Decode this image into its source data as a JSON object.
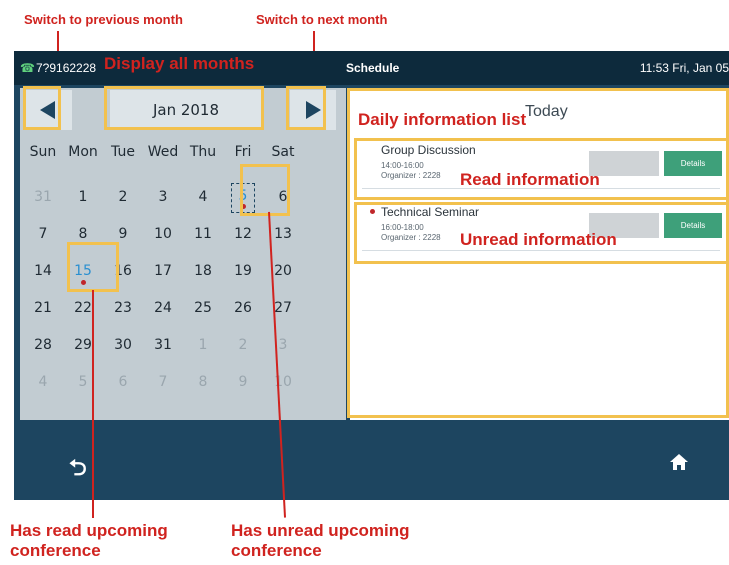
{
  "annotations": {
    "prev_month": "Switch to previous month",
    "next_month": "Switch to next month",
    "display_all": "Display all months",
    "daily_list": "Daily information list",
    "read_info": "Read information",
    "unread_info": "Unread information",
    "read_conf_line1": "Has read upcoming",
    "read_conf_line2": "conference",
    "unread_conf_line1": "Has unread upcoming",
    "unread_conf_line2": "conference"
  },
  "statusbar": {
    "phone_icon": "phone-icon",
    "number": "7?9162228",
    "title": "Schedule",
    "time": "11:53 Fri, Jan 05"
  },
  "calendar": {
    "month_label": "Jan 2018",
    "weekdays": [
      "Sun",
      "Mon",
      "Tue",
      "Wed",
      "Thu",
      "Fri",
      "Sat"
    ],
    "weeks": [
      [
        "31",
        "1",
        "2",
        "3",
        "4",
        "5",
        "6"
      ],
      [
        "7",
        "8",
        "9",
        "10",
        "11",
        "12",
        "13"
      ],
      [
        "14",
        "15",
        "16",
        "17",
        "18",
        "19",
        "20"
      ],
      [
        "21",
        "22",
        "23",
        "24",
        "25",
        "26",
        "27"
      ],
      [
        "28",
        "29",
        "30",
        "31",
        "1",
        "2",
        "3"
      ],
      [
        "4",
        "5",
        "6",
        "7",
        "8",
        "9",
        "10"
      ]
    ]
  },
  "list": {
    "today_label": "Today",
    "events": [
      {
        "title": "Group Discussion",
        "time": "14:00-16:00",
        "organizer": "Organizer : 2228",
        "details_label": "Details",
        "unread": false
      },
      {
        "title": "Technical Seminar",
        "time": "16:00-18:00",
        "organizer": "Organizer : 2228",
        "details_label": "Details",
        "unread": true
      }
    ]
  },
  "bottombar": {
    "back_icon": "back-icon",
    "home_icon": "home-icon"
  },
  "colors": {
    "accent_annotation": "#d0231f",
    "highlight": "#f2c14e",
    "screen_bg": "#1d4560",
    "details_button": "#3ea07a",
    "selected_day": "#2a8fd0"
  }
}
